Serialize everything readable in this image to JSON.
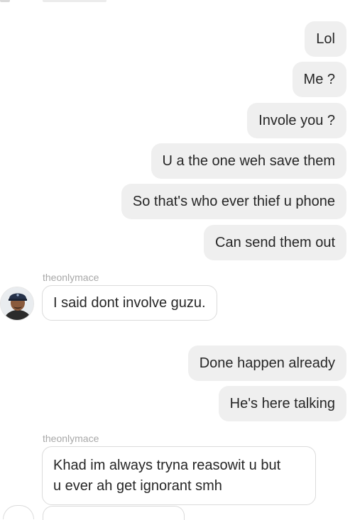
{
  "conversation": {
    "messages": [
      {
        "direction": "out",
        "text": "Lol"
      },
      {
        "direction": "out",
        "text": "Me ?"
      },
      {
        "direction": "out",
        "text": "Invole you ?"
      },
      {
        "direction": "out",
        "text": "U a the one weh save them"
      },
      {
        "direction": "out",
        "text": "So that's who ever thief u phone"
      },
      {
        "direction": "out",
        "text": "Can send them out"
      },
      {
        "direction": "in",
        "sender": "theonlymace",
        "text": "I said dont involve guzu."
      },
      {
        "direction": "out",
        "text": "Done happen already"
      },
      {
        "direction": "out",
        "text": "He's here talking"
      },
      {
        "direction": "in",
        "sender": "theonlymace",
        "lines": [
          "Khad im always tryna reasowit u but",
          "u ever ah get ignorant smh"
        ]
      }
    ]
  },
  "colors": {
    "outgoing_bubble": "#efefef",
    "incoming_border": "#dbdbdb",
    "sender_name": "#a8a8a8",
    "text": "#262626"
  },
  "icons": {
    "avatar": "user-avatar-photo"
  }
}
